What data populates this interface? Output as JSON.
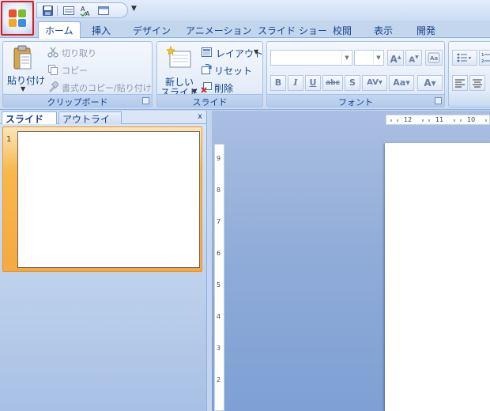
{
  "tabs": {
    "home": "ホーム",
    "insert": "挿入",
    "design": "デザイン",
    "animation": "アニメーション",
    "slideshow": "スライド ショー",
    "review": "校閲",
    "view": "表示",
    "developer": "開発"
  },
  "clipboard": {
    "paste": "貼り付け",
    "cut": "切り取り",
    "copy": "コピー",
    "format_painter": "書式のコピー/貼り付け",
    "label": "クリップボード"
  },
  "slides": {
    "new_slide_line1": "新しい",
    "new_slide_line2": "スライド",
    "layout": "レイアウト",
    "reset": "リセット",
    "delete": "削除",
    "label": "スライド"
  },
  "font": {
    "label": "フォント",
    "bold": "B",
    "italic": "I",
    "underline": "U",
    "strike": "abc",
    "shadow": "S",
    "spacing": "AV",
    "case": "Aa",
    "color": "A"
  },
  "pane": {
    "slides_tab": "スライド",
    "outline_tab": "アウトライン",
    "close": "x",
    "slide_number": "1"
  },
  "ruler": {
    "h_marks": [
      "12",
      "11",
      "10"
    ],
    "v_marks": [
      "9",
      "8",
      "7",
      "6",
      "5",
      "4",
      "3",
      "2"
    ]
  },
  "colors": {
    "office_button_highlight": "#e01818",
    "selection": "#f6a941"
  }
}
